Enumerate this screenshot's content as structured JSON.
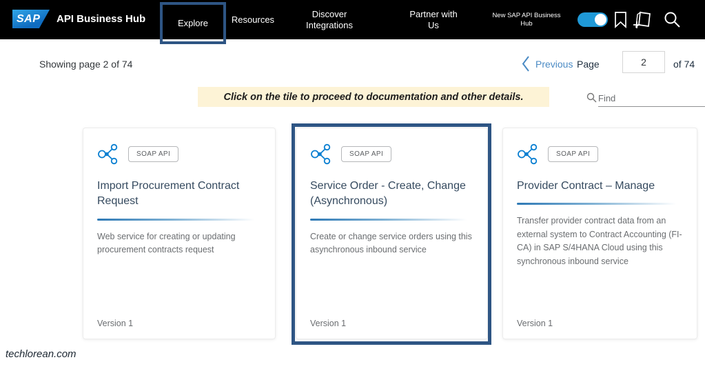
{
  "nav": {
    "sap_logo": "SAP",
    "title": "API Business Hub",
    "explore": "Explore",
    "resources": "Resources",
    "discover_line1": "Discover",
    "discover_line2": "Integrations",
    "partner_line1": "Partner with",
    "partner_line2": "Us",
    "new_hub_line1": "New SAP API Business",
    "new_hub_line2": "Hub",
    "toggle_state": "on"
  },
  "pagination": {
    "showing": "Showing page 2 of 74",
    "previous": "Previous",
    "page_label": "Page",
    "page_value": "2",
    "of_label": "of  74"
  },
  "banner": {
    "text": "Click on the tile to proceed to documentation and other details."
  },
  "find": {
    "placeholder": "Find"
  },
  "cards": [
    {
      "badge": "SOAP API",
      "title": "Import Procurement Contract Request",
      "description": "Web service for creating or updating procurement contracts request",
      "version": "Version 1",
      "highlighted": false
    },
    {
      "badge": "SOAP API",
      "title": "Service Order - Create, Change (Asynchronous)",
      "description": "Create or change service orders using this asynchronous inbound service",
      "version": "Version 1",
      "highlighted": true
    },
    {
      "badge": "SOAP API",
      "title": "Provider Contract – Manage",
      "description": "Transfer provider contract data from an external system to Contract Accounting (FI-CA) in SAP S/4HANA Cloud using this synchronous inbound service",
      "version": "Version 1",
      "highlighted": false
    }
  ],
  "watermark": "techlorean.com",
  "colors": {
    "nav_bg": "#000000",
    "annotation_blue": "#2e5584",
    "accent_blue": "#0a7fd1",
    "toggle_blue": "#1f99d7",
    "banner_bg": "#fdf3d6",
    "link_blue": "#4a8ac4",
    "title_text": "#354a5f",
    "body_text": "#6a6d70"
  }
}
